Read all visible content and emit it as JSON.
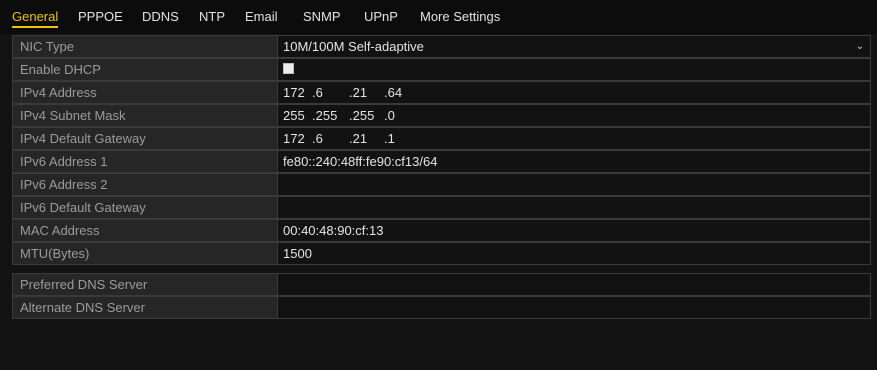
{
  "tabs": [
    {
      "label": "General"
    },
    {
      "label": "PPPOE"
    },
    {
      "label": "DDNS"
    },
    {
      "label": "NTP"
    },
    {
      "label": "Email"
    },
    {
      "label": "SNMP"
    },
    {
      "label": "UPnP"
    },
    {
      "label": "More Settings"
    }
  ],
  "active_tab": "General",
  "form": {
    "nic_type": {
      "label": "NIC Type",
      "value": "10M/100M Self-adaptive"
    },
    "enable_dhcp": {
      "label": "Enable DHCP",
      "checked": false
    },
    "ipv4_address": {
      "label": "IPv4 Address",
      "octets": [
        "172",
        ".6",
        ".21",
        ".64"
      ]
    },
    "ipv4_subnet_mask": {
      "label": "IPv4 Subnet Mask",
      "octets": [
        "255",
        ".255",
        ".255",
        ".0"
      ]
    },
    "ipv4_default_gateway": {
      "label": "IPv4 Default Gateway",
      "octets": [
        "172",
        ".6",
        ".21",
        ".1"
      ]
    },
    "ipv6_address_1": {
      "label": "IPv6 Address 1",
      "value": "fe80::240:48ff:fe90:cf13/64"
    },
    "ipv6_address_2": {
      "label": "IPv6 Address 2",
      "value": ""
    },
    "ipv6_default_gateway": {
      "label": "IPv6 Default Gateway",
      "value": ""
    },
    "mac_address": {
      "label": "MAC Address",
      "value": "00:40:48:90:cf:13"
    },
    "mtu": {
      "label": "MTU(Bytes)",
      "value": "1500"
    },
    "preferred_dns": {
      "label": "Preferred DNS Server",
      "value": ""
    },
    "alternate_dns": {
      "label": "Alternate DNS Server",
      "value": ""
    }
  },
  "icons": {
    "dropdown": "chevron-down-icon"
  },
  "colors": {
    "accent": "#f0c400",
    "label_bg": "#262626",
    "value_bg": "#121212",
    "border": "#3a3a3a"
  }
}
